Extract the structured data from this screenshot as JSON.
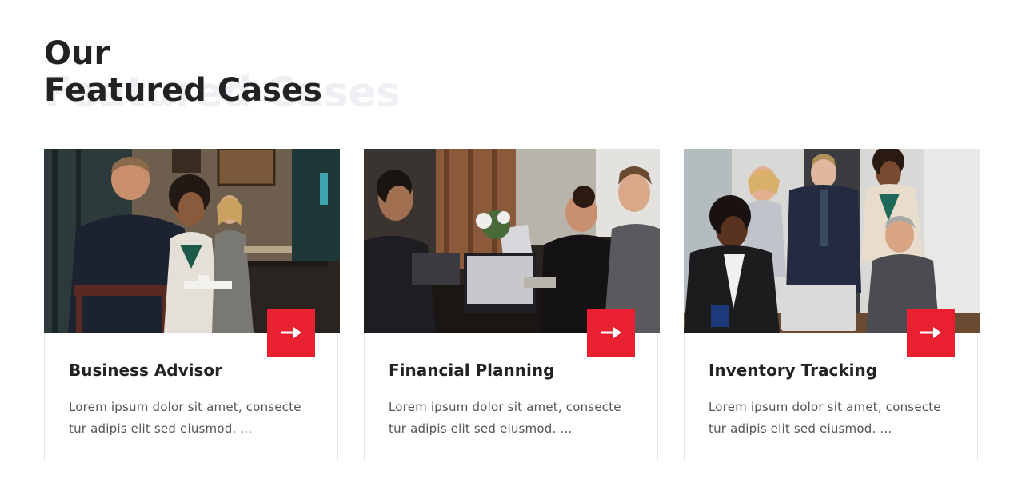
{
  "section": {
    "title_line1": "Our",
    "title_line2": "Featured Cases",
    "ghost_text": "Featured Cases"
  },
  "colors": {
    "accent": "#e8202f",
    "heading": "#222222",
    "body_text": "#555555",
    "ghost": "#eef0f4",
    "card_border": "#e6e6e6"
  },
  "cards": [
    {
      "title": "Business Advisor",
      "text": "Lorem ipsum dolor sit amet, consecte tur adipis elit sed eiusmod. ...",
      "image_desc": "business-meeting-cafe-photo",
      "button_icon": "arrow-right-icon"
    },
    {
      "title": "Financial Planning",
      "text": "Lorem ipsum dolor sit amet, consecte tur adipis elit sed eiusmod. ...",
      "image_desc": "team-working-laptops-photo",
      "button_icon": "arrow-right-icon"
    },
    {
      "title": "Inventory Tracking",
      "text": "Lorem ipsum dolor sit amet, consecte tur adipis elit sed eiusmod. ...",
      "image_desc": "team-laptop-meeting-photo",
      "button_icon": "arrow-right-icon"
    }
  ]
}
